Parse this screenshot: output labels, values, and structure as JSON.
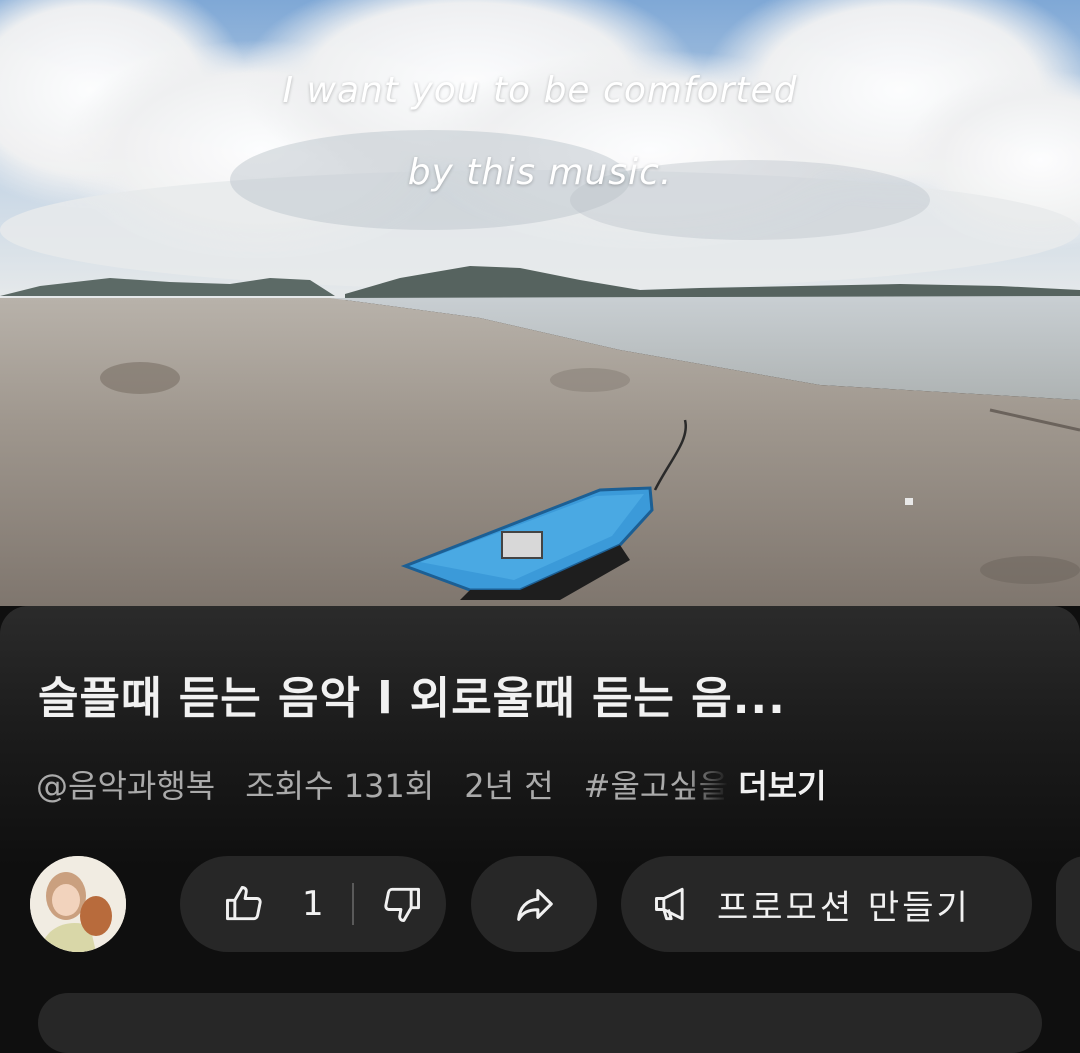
{
  "video": {
    "caption_line1": "I want you to be comforted",
    "caption_line2": "by this music."
  },
  "title": "슬플때 듣는 음악 l 외로울때 듣는 음...",
  "meta": {
    "channel": "@음악과행복",
    "views": "조회수 131회",
    "age": "2년 전",
    "hashtag": "#울고싶을",
    "more_label": "더보기"
  },
  "actions": {
    "like_count": "1",
    "promo_label": "프로모션 만들기"
  },
  "icons": {
    "like": "thumbs-up-icon",
    "dislike": "thumbs-down-icon",
    "share": "share-arrow-icon",
    "promo": "megaphone-icon"
  },
  "colors": {
    "background": "#0f0f0f",
    "pill": "#272727",
    "text_primary": "#f1f1f1",
    "text_secondary": "#aaaaaa",
    "boat": "#3b9ad9"
  }
}
